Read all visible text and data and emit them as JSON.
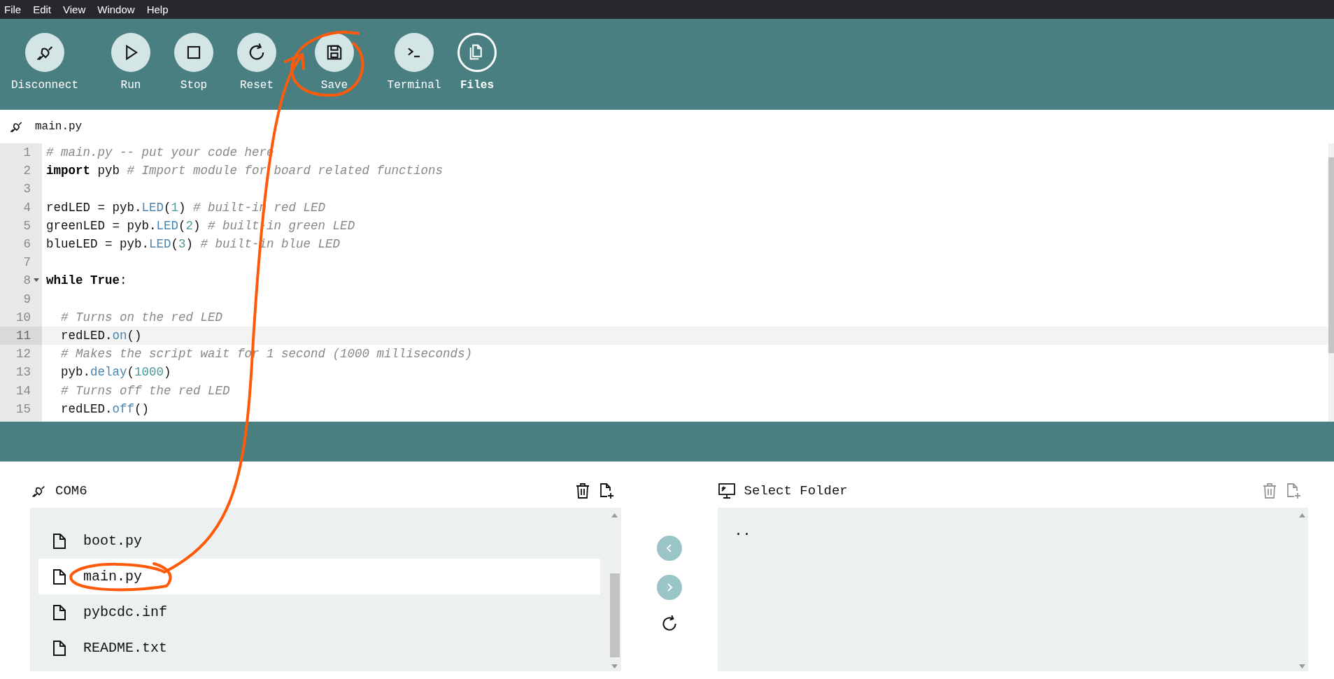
{
  "menu_bar": [
    "File",
    "Edit",
    "View",
    "Window",
    "Help"
  ],
  "toolbar": [
    {
      "kind": "disconnect",
      "label": "Disconnect",
      "selected": false
    },
    {
      "kind": "run",
      "label": "Run",
      "selected": false
    },
    {
      "kind": "stop",
      "label": "Stop",
      "selected": false
    },
    {
      "kind": "reset",
      "label": "Reset",
      "selected": false
    },
    {
      "kind": "save",
      "label": "Save",
      "selected": false
    },
    {
      "kind": "terminal",
      "label": "Terminal",
      "selected": false
    },
    {
      "kind": "files",
      "label": "Files",
      "selected": true
    }
  ],
  "editor_tab": {
    "title": "main.py"
  },
  "editor": {
    "lines": [
      {
        "number": "1",
        "active": false,
        "foldable": false,
        "tokens": [
          {
            "kind": "comment",
            "text": "# main.py -- put your code here"
          }
        ]
      },
      {
        "number": "2",
        "active": false,
        "foldable": false,
        "tokens": [
          {
            "kind": "keyword",
            "text": "import"
          },
          {
            "kind": "plain",
            "text": " pyb "
          },
          {
            "kind": "comment",
            "text": "# Import module for board related functions"
          }
        ]
      },
      {
        "number": "3",
        "active": false,
        "foldable": false
      },
      {
        "number": "4",
        "active": false,
        "foldable": false,
        "tokens": [
          {
            "kind": "plain",
            "text": "redLED = pyb."
          },
          {
            "kind": "property",
            "text": "LED"
          },
          {
            "kind": "plain",
            "text": "("
          },
          {
            "kind": "number",
            "text": "1"
          },
          {
            "kind": "plain",
            "text": ") "
          },
          {
            "kind": "comment",
            "text": "# built-in red LED"
          }
        ]
      },
      {
        "number": "5",
        "active": false,
        "foldable": false,
        "tokens": [
          {
            "kind": "plain",
            "text": "greenLED = pyb."
          },
          {
            "kind": "property",
            "text": "LED"
          },
          {
            "kind": "plain",
            "text": "("
          },
          {
            "kind": "number",
            "text": "2"
          },
          {
            "kind": "plain",
            "text": ") "
          },
          {
            "kind": "comment",
            "text": "# built-in green LED"
          }
        ]
      },
      {
        "number": "6",
        "active": false,
        "foldable": false,
        "tokens": [
          {
            "kind": "plain",
            "text": "blueLED = pyb."
          },
          {
            "kind": "property",
            "text": "LED"
          },
          {
            "kind": "plain",
            "text": "("
          },
          {
            "kind": "number",
            "text": "3"
          },
          {
            "kind": "plain",
            "text": ") "
          },
          {
            "kind": "comment",
            "text": "# built-in blue LED"
          }
        ]
      },
      {
        "number": "7",
        "active": false,
        "foldable": false
      },
      {
        "number": "8",
        "active": false,
        "foldable": true,
        "tokens": [
          {
            "kind": "keyword",
            "text": "while"
          },
          {
            "kind": "keyword",
            "text": " True"
          },
          {
            "kind": "plain",
            "text": ":"
          }
        ]
      },
      {
        "number": "9",
        "active": false,
        "foldable": false
      },
      {
        "number": "10",
        "active": false,
        "foldable": false,
        "children": [
          {
            "kind": "comment",
            "text": "# Turns on the red LED"
          }
        ]
      },
      {
        "number": "11",
        "active": true,
        "foldable": false,
        "children": [
          {
            "kind": "plain",
            "text": "redLED."
          },
          {
            "kind": "property",
            "text": "on"
          },
          {
            "kind": "plain",
            "text": "()"
          }
        ]
      },
      {
        "number": "12",
        "active": false,
        "foldable": false,
        "children": [
          {
            "kind": "comment",
            "text": "# Makes the script wait for 1 second (1000 milliseconds)"
          }
        ]
      },
      {
        "number": "13",
        "active": false,
        "foldable": false,
        "children": [
          {
            "kind": "plain",
            "text": "pyb."
          },
          {
            "kind": "property",
            "text": "delay"
          },
          {
            "kind": "plain",
            "text": "("
          },
          {
            "kind": "number",
            "text": "1000"
          },
          {
            "kind": "plain",
            "text": ")"
          }
        ]
      },
      {
        "number": "14",
        "active": false,
        "foldable": false,
        "children": [
          {
            "kind": "comment",
            "text": "# Turns off the red LED"
          }
        ]
      },
      {
        "number": "15",
        "active": false,
        "foldable": false,
        "children": [
          {
            "kind": "plain",
            "text": "redLED."
          },
          {
            "kind": "property",
            "text": "off"
          },
          {
            "kind": "plain",
            "text": "()"
          }
        ]
      }
    ]
  },
  "device_panel": {
    "title": "COM6",
    "actions_disabled": false,
    "files": [
      {
        "name": "boot.py",
        "selected": false
      },
      {
        "name": "main.py",
        "selected": true
      },
      {
        "name": "pybcdc.inf",
        "selected": false
      },
      {
        "name": "README.txt",
        "selected": false
      }
    ]
  },
  "local_panel": {
    "title": "Select Folder",
    "actions_disabled": true,
    "files": [
      {
        "name": "..",
        "selected": false
      }
    ]
  }
}
